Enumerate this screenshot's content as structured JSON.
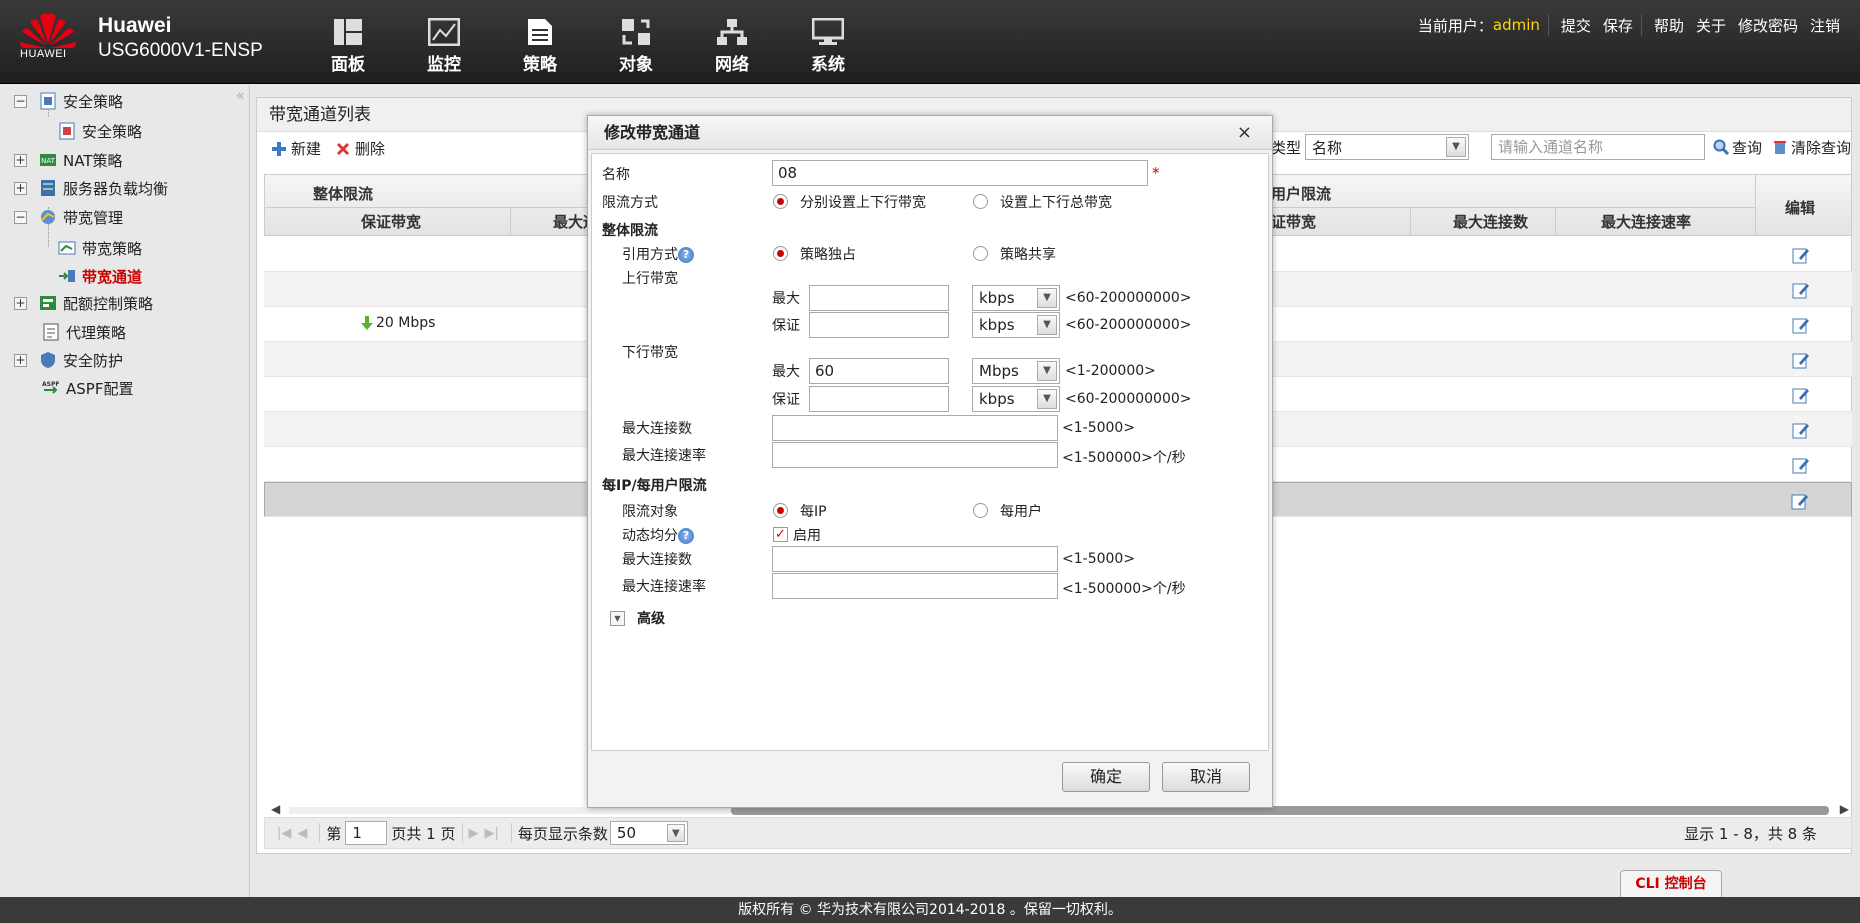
{
  "header": {
    "logo_text": "HUAWEI",
    "brand": "Huawei",
    "model": "USG6000V1-ENSP",
    "nav": [
      "面板",
      "监控",
      "策略",
      "对象",
      "网络",
      "系统"
    ],
    "user_label": "当前用户：",
    "user": "admin",
    "links": [
      "提交",
      "保存",
      "帮助",
      "关于",
      "修改密码",
      "注销"
    ]
  },
  "sidebar": {
    "collapse": "«",
    "items": [
      {
        "label": "安全策略",
        "toggle": "−"
      },
      {
        "label": "安全策略"
      },
      {
        "label": "NAT策略",
        "toggle": "+"
      },
      {
        "label": "服务器负载均衡",
        "toggle": "+"
      },
      {
        "label": "带宽管理",
        "toggle": "−"
      },
      {
        "label": "带宽策略"
      },
      {
        "label": "带宽通道"
      },
      {
        "label": "配额控制策略",
        "toggle": "+"
      },
      {
        "label": "代理策略"
      },
      {
        "label": "安全防护",
        "toggle": "+"
      },
      {
        "label": "ASPF配置"
      }
    ]
  },
  "main": {
    "title": "带宽通道列表",
    "new_label": "新建",
    "delete_label": "删除",
    "search_type_label": "类型",
    "search_type_value": "名称",
    "search_placeholder": "请输入通道名称",
    "query_label": "查询",
    "clear_label": "清除查询",
    "columns": {
      "group_whole": "整体限流",
      "guarantee": "保证带宽",
      "max_partial": "最大通",
      "group_user": "用户限流",
      "user_guarantee": "证带宽",
      "max_conn": "最大连接数",
      "max_rate": "最大连接速率",
      "edit": "编辑"
    },
    "row_value": "20 Mbps",
    "pager": {
      "page_prefix": "第",
      "page": "1",
      "page_suffix": "页共 1 页",
      "per_page_label": "每页显示条数",
      "per_page": "50",
      "info": "显示 1 - 8，共 8 条"
    }
  },
  "dialog": {
    "title": "修改带宽通道",
    "close": "×",
    "name_label": "名称",
    "name_value": "08",
    "required": "*",
    "limit_mode_label": "限流方式",
    "limit_mode_opt1": "分别设置上下行带宽",
    "limit_mode_opt2": "设置上下行总带宽",
    "whole_section": "整体限流",
    "ref_mode_label": "引用方式",
    "ref_opt1": "策略独占",
    "ref_opt2": "策略共享",
    "up_bw": "上行带宽",
    "down_bw": "下行带宽",
    "max": "最大",
    "guarantee": "保证",
    "up_max_unit": "kbps",
    "up_max_range": "<60-200000000>",
    "up_gua_unit": "kbps",
    "up_gua_range": "<60-200000000>",
    "down_max_value": "60",
    "down_max_unit": "Mbps",
    "down_max_range": "<1-200000>",
    "down_gua_unit": "kbps",
    "down_gua_range": "<60-200000000>",
    "max_conn_label": "最大连接数",
    "max_conn_range": "<1-5000>",
    "max_rate_label": "最大连接速率",
    "max_rate_range": "<1-500000>个/秒",
    "per_section": "每IP/每用户限流",
    "target_label": "限流对象",
    "target_opt1": "每IP",
    "target_opt2": "每用户",
    "dynamic_label": "动态均分",
    "dynamic_enable": "启用",
    "per_max_conn_label": "最大连接数",
    "per_max_conn_range": "<1-5000>",
    "per_max_rate_label": "最大连接速率",
    "per_max_rate_range": "<1-500000>个/秒",
    "advanced": "高级",
    "ok": "确定",
    "cancel": "取消"
  },
  "footer": {
    "copyright": "版权所有 © 华为技术有限公司2014-2018 。保留一切权利。",
    "cli": "CLI 控制台"
  },
  "colors": {
    "accent": "#cc0000",
    "admin": "#ffd800",
    "header_bg": "#2b2b2b"
  }
}
